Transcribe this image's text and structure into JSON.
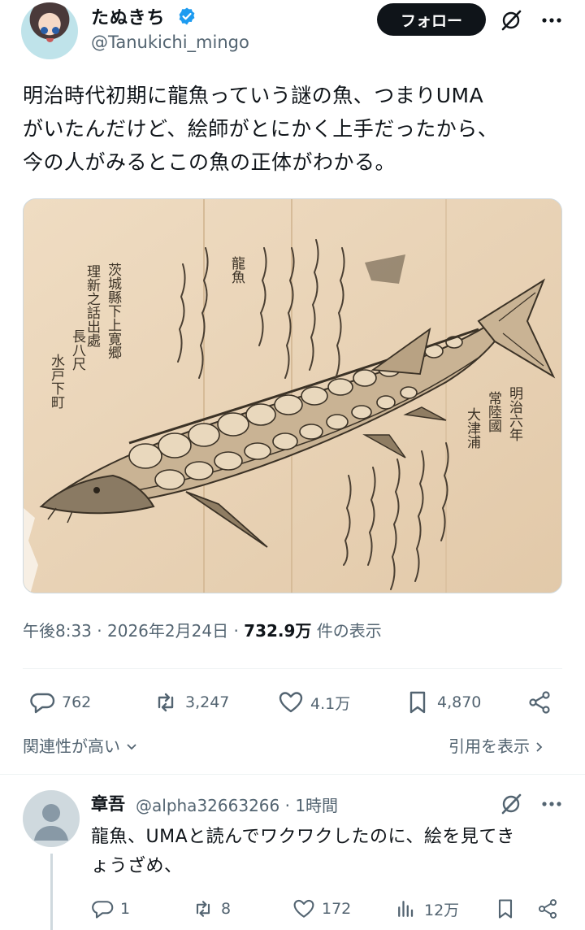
{
  "post": {
    "author": {
      "name": "たぬきち",
      "handle": "@Tanukichi_mingo"
    },
    "follow_label": "フォロー",
    "text_lines": [
      "明治時代初期に龍魚っていう謎の魚、つまりUMA",
      "がいたんだけど、絵師がとにかく上手だったから、",
      "今の人がみるとこの魚の正体がわかる。"
    ],
    "image_text": {
      "col1": "茨城縣下上寛郷",
      "col2": "理新之話出處",
      "col3": "長八尺",
      "col4": "水戸下町",
      "col5": "龍魚",
      "col6": "常陸國",
      "col7": "大津浦",
      "col8": "明治六年"
    },
    "time": "午後8:33",
    "date": "2026年2月24日",
    "views_value": "732.9万",
    "views_label": "件の表示",
    "separator": "·",
    "stats": {
      "replies": "762",
      "reposts": "3,247",
      "likes": "4.1万",
      "bookmarks": "4,870"
    },
    "related_label": "関連性が高い",
    "quotes_label": "引用を表示"
  },
  "reply": {
    "name": "章吾",
    "handle": "@alpha32663266",
    "time": "1時間",
    "text_lines": [
      "龍魚、UMAと読んでワクワクしたのに、絵を見てき",
      "ょうざめ、"
    ],
    "stats": {
      "replies": "1",
      "reposts": "8",
      "likes": "172",
      "views": "12万"
    }
  },
  "colors": {
    "primary_text": "#0f1419",
    "secondary_text": "#536471",
    "verified_blue": "#1d9bf0",
    "divider": "#eff3f4",
    "paper": "#e8d3b8",
    "ink": "#3b3226"
  },
  "icons": [
    "verified-badge-icon",
    "grok-icon",
    "more-icon",
    "reply-icon",
    "repost-icon",
    "like-icon",
    "bookmark-icon",
    "share-icon",
    "views-icon",
    "chevron-down-icon",
    "chevron-right-icon"
  ]
}
